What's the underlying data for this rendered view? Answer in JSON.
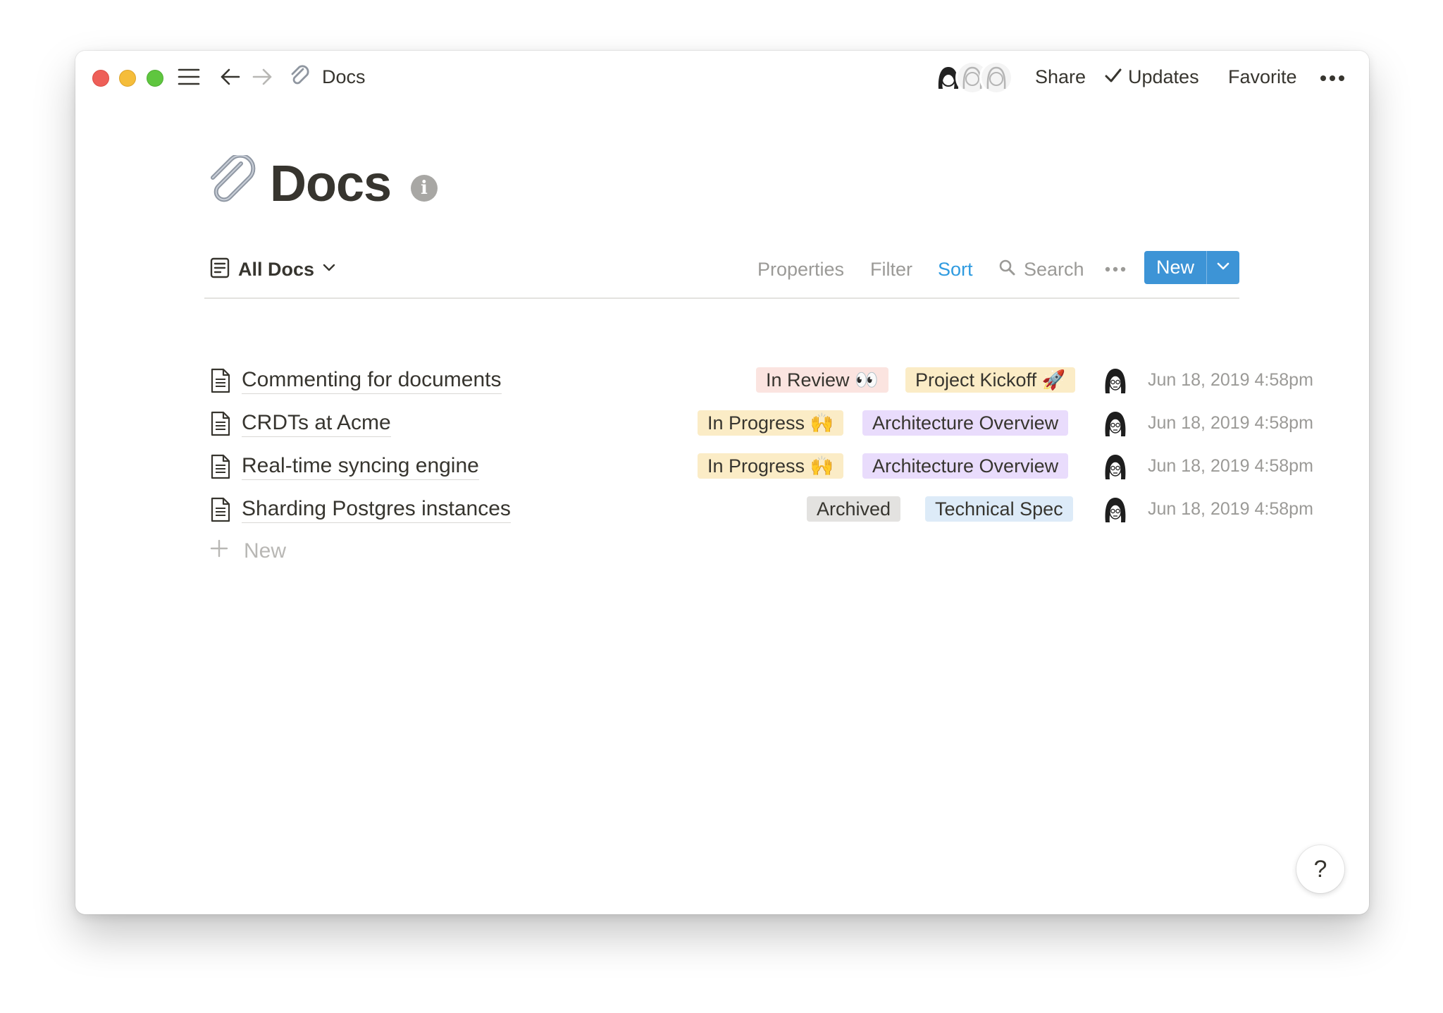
{
  "titlebar": {
    "breadcrumb": "Docs",
    "share_label": "Share",
    "updates_label": "Updates",
    "favorite_label": "Favorite"
  },
  "page": {
    "title": "Docs"
  },
  "viewbar": {
    "view_name": "All Docs",
    "properties_label": "Properties",
    "filter_label": "Filter",
    "sort_label": "Sort",
    "search_label": "Search",
    "new_label": "New"
  },
  "rows": [
    {
      "title": "Commenting for documents",
      "status": "In Review 👀",
      "category": "Project Kickoff 🚀",
      "date": "Jun 18, 2019 4:58pm"
    },
    {
      "title": "CRDTs at Acme",
      "status": "In Progress 🙌",
      "category": "Architecture Overview",
      "date": "Jun 18, 2019 4:58pm"
    },
    {
      "title": "Real-time syncing engine",
      "status": "In Progress 🙌",
      "category": "Architecture Overview",
      "date": "Jun 18, 2019 4:58pm"
    },
    {
      "title": "Sharding Postgres instances",
      "status": "Archived",
      "category": "Technical Spec",
      "date": "Jun 18, 2019 4:58pm"
    }
  ],
  "add_row_label": "New",
  "help_label": "?",
  "colors": {
    "accent": "#3d94d6",
    "sort_active": "#2f9be0",
    "tag_in_review": "#fbe4e0",
    "tag_in_progress": "#fbecc6",
    "tag_architecture": "#e9dcfc",
    "tag_archived": "#e3e2e0",
    "tag_technical_spec": "#ddebf8"
  }
}
